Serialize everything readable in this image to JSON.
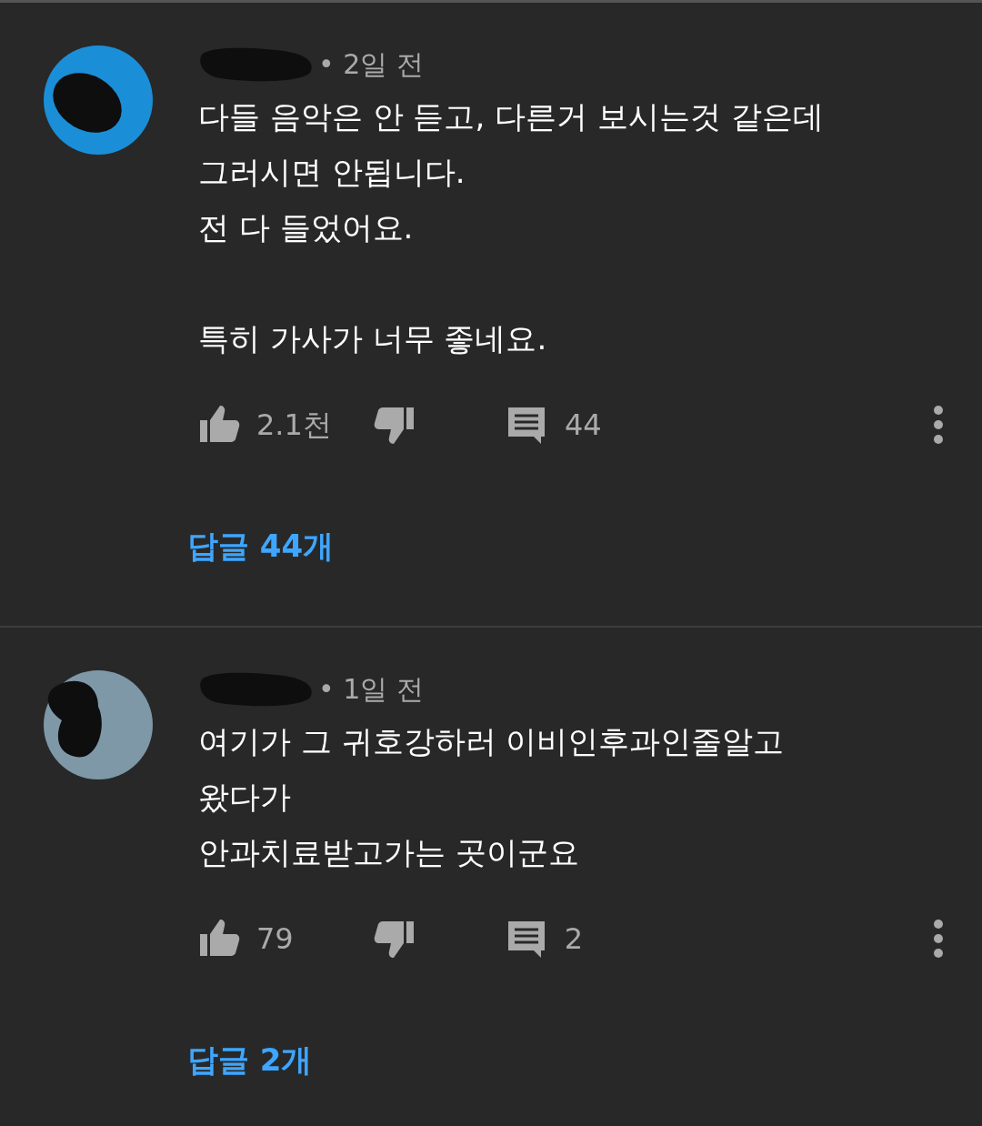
{
  "comments": [
    {
      "avatar": {
        "color": "#1a8fd8"
      },
      "meta": "• 2일 전",
      "body": "다들 음악은 안 듣고, 다른거 보시는것 같은데\n그러시면 안됩니다.\n전 다 들었어요.\n\n특히 가사가 너무 좋네요.",
      "likes": "2.1천",
      "comment_count": "44",
      "replies": "답글 44개"
    },
    {
      "avatar": {
        "color": "#7e98a8"
      },
      "meta": "• 1일 전",
      "body": "여기가 그 귀호강하러 이비인후과인줄알고\n왔다가\n안과치료받고가는 곳이군요",
      "likes": "79",
      "comment_count": "2",
      "replies": "답글 2개"
    }
  ]
}
